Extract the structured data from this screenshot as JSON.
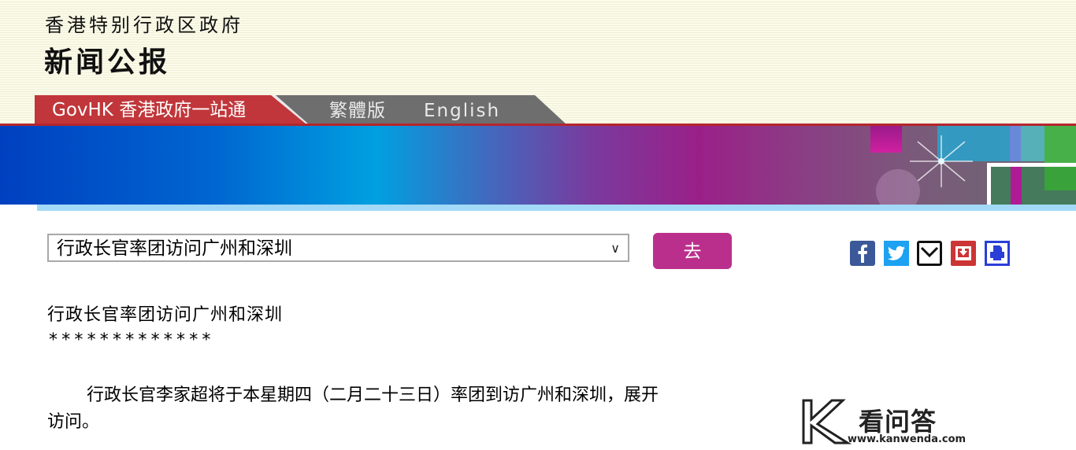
{
  "header": {
    "gov_title": "香港特别行政区政府",
    "section_title": "新闻公报"
  },
  "tabs": {
    "govhk": "GovHK 香港政府一站通",
    "traditional": "繁體版",
    "english": "English"
  },
  "navigation": {
    "selected_option": "行政长官率团访问广州和深圳",
    "go_label": "去"
  },
  "share_icons": [
    "facebook-icon",
    "twitter-icon",
    "email-icon",
    "download-icon",
    "print-icon"
  ],
  "article": {
    "headline": "行政长官率团访问广州和深圳",
    "separator": "*************",
    "paragraph_visible": "行政长官李家超将于本星期四（二月二十三日）率团到访广州和深圳，展开",
    "paragraph_tail": "访问。"
  },
  "watermark": {
    "name": "看问答",
    "url": "www.kanwenda.com"
  },
  "colors": {
    "govhk_tab": "#c0363a",
    "tab_gray": "#6e6e6e",
    "go_button": "#bb2f8c",
    "banner_start": "#0040c0",
    "banner_mid": "#9a2088",
    "light_strip": "#a2d9f7"
  }
}
